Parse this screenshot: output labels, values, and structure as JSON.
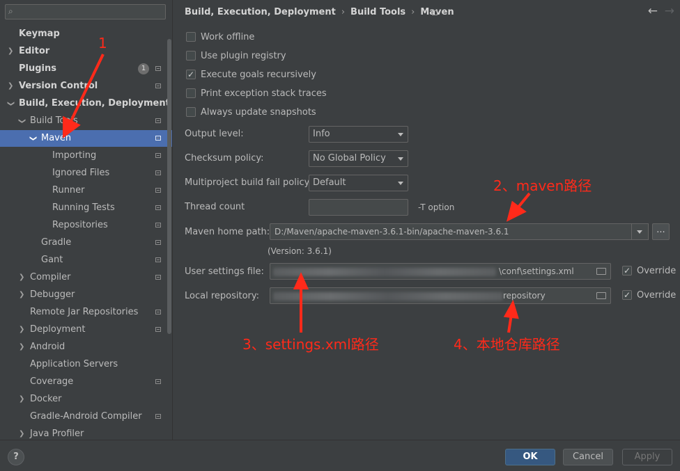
{
  "sidebar": {
    "search_placeholder": "",
    "items": [
      {
        "label": "Keymap"
      },
      {
        "label": "Editor"
      },
      {
        "label": "Plugins",
        "badge": "1"
      },
      {
        "label": "Version Control"
      },
      {
        "label": "Build, Execution, Deployment"
      },
      {
        "label": "Build Tools"
      },
      {
        "label": "Maven"
      },
      {
        "label": "Importing"
      },
      {
        "label": "Ignored Files"
      },
      {
        "label": "Runner"
      },
      {
        "label": "Running Tests"
      },
      {
        "label": "Repositories"
      },
      {
        "label": "Gradle"
      },
      {
        "label": "Gant"
      },
      {
        "label": "Compiler"
      },
      {
        "label": "Debugger"
      },
      {
        "label": "Remote Jar Repositories"
      },
      {
        "label": "Deployment"
      },
      {
        "label": "Android"
      },
      {
        "label": "Application Servers"
      },
      {
        "label": "Coverage"
      },
      {
        "label": "Docker"
      },
      {
        "label": "Gradle-Android Compiler"
      },
      {
        "label": "Java Profiler"
      }
    ]
  },
  "breadcrumb": [
    "Build, Execution, Deployment",
    "Build Tools",
    "Maven"
  ],
  "checkboxes": [
    {
      "label": "Work offline",
      "checked": false
    },
    {
      "label": "Use plugin registry",
      "checked": false
    },
    {
      "label": "Execute goals recursively",
      "checked": true
    },
    {
      "label": "Print exception stack traces",
      "checked": false
    },
    {
      "label": "Always update snapshots",
      "checked": false
    }
  ],
  "fields": {
    "output_level": {
      "label": "Output level:",
      "value": "Info"
    },
    "checksum_policy": {
      "label": "Checksum policy:",
      "value": "No Global Policy"
    },
    "multiproject_policy": {
      "label": "Multiproject build fail policy:",
      "value": "Default"
    },
    "thread_count": {
      "label": "Thread count",
      "value": "",
      "hint": "-T option"
    },
    "maven_home": {
      "label": "Maven home path:",
      "value": "D:/Maven/apache-maven-3.6.1-bin/apache-maven-3.6.1",
      "version": "(Version: 3.6.1)"
    },
    "user_settings": {
      "label": "User settings file:",
      "value": "\\conf\\settings.xml",
      "override": "Override"
    },
    "local_repo": {
      "label": "Local repository:",
      "value": "repository",
      "override": "Override"
    }
  },
  "annotations": {
    "a1": "1",
    "a2": "2、maven路径",
    "a3": "3、settings.xml路径",
    "a4": "4、本地仓库路径"
  },
  "footer": {
    "help": "?",
    "ok": "OK",
    "cancel": "Cancel",
    "apply": "Apply"
  },
  "colors": {
    "selection": "#4b6eaf",
    "annotation": "#ff2a1a",
    "ok_button": "#365880"
  }
}
